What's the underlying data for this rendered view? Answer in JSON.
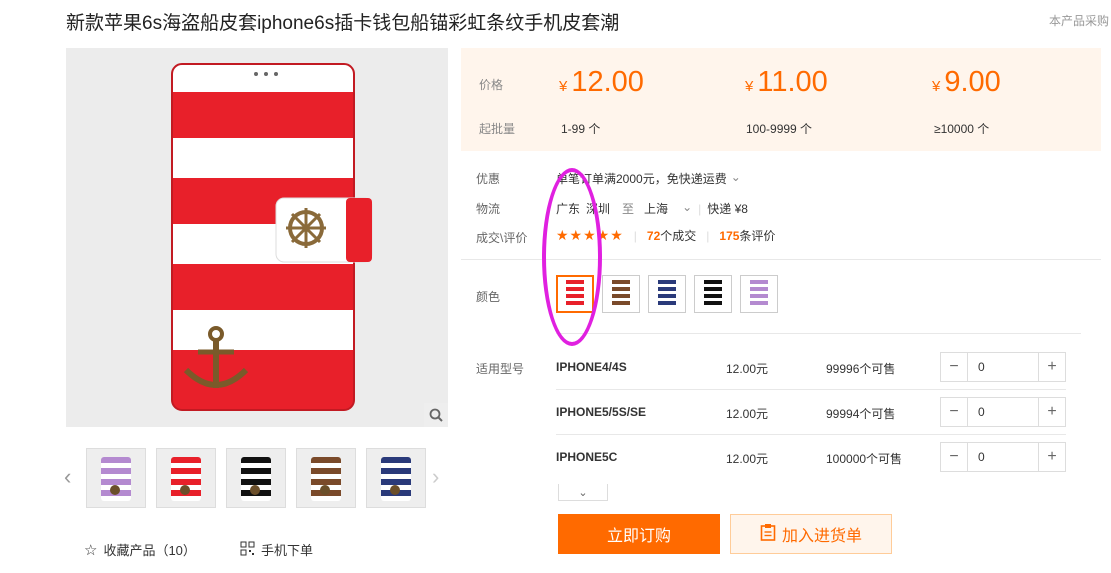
{
  "title": "新款苹果6s海盗船皮套iphone6s插卡钱包船锚彩虹条纹手机皮套潮",
  "corner": "本产品采购",
  "price_table": {
    "price_label": "价格",
    "qty_label": "起批量",
    "tiers": [
      {
        "currency": "¥",
        "price": "12.00",
        "qty": "1-99 个"
      },
      {
        "currency": "¥",
        "price": "11.00",
        "qty": "100-9999 个"
      },
      {
        "currency": "¥",
        "price": "9.00",
        "qty": "≥10000 个"
      }
    ]
  },
  "promo": {
    "label": "优惠",
    "text": "单笔订单满2000元，免快递运费"
  },
  "logistics": {
    "label": "物流",
    "from_province": "广东",
    "from_city": "深圳",
    "to_word": "至",
    "to_city": "上海",
    "express": "快递 ¥8"
  },
  "deals": {
    "label": "成交\\评价",
    "stars": "★★★★★",
    "sales_count": "72",
    "sales_suffix": "个成交",
    "reviews_count": "175",
    "reviews_suffix": "条评价"
  },
  "color": {
    "label": "颜色",
    "swatches": [
      {
        "name": "red",
        "stripe": "#e8202a"
      },
      {
        "name": "brown",
        "stripe": "#7a4a2a"
      },
      {
        "name": "navy",
        "stripe": "#2a3a7a"
      },
      {
        "name": "black",
        "stripe": "#111111"
      },
      {
        "name": "purple",
        "stripe": "#b48ad0"
      }
    ]
  },
  "models": {
    "label": "适用型号",
    "rows": [
      {
        "name": "IPHONE4/4S",
        "price": "12.00元",
        "stock": "99996个可售",
        "qty": "0"
      },
      {
        "name": "IPHONE5/5S/SE",
        "price": "12.00元",
        "stock": "99994个可售",
        "qty": "0"
      },
      {
        "name": "IPHONE5C",
        "price": "12.00元",
        "stock": "100000个可售",
        "qty": "0"
      }
    ]
  },
  "actions": {
    "buy": "立即订购",
    "cart": "加入进货单"
  },
  "footer": {
    "favorite": "收藏产品（10）",
    "mobile": "手机下单"
  },
  "thumbnails": [
    {
      "stripe": "#b48ad0"
    },
    {
      "stripe": "#e8202a"
    },
    {
      "stripe": "#111111"
    },
    {
      "stripe": "#7a4a2a"
    },
    {
      "stripe": "#2a3a7a"
    }
  ],
  "colors": {
    "accent": "#ff6a00",
    "price_bg": "#fff5ec",
    "annotation": "#e020e0"
  }
}
